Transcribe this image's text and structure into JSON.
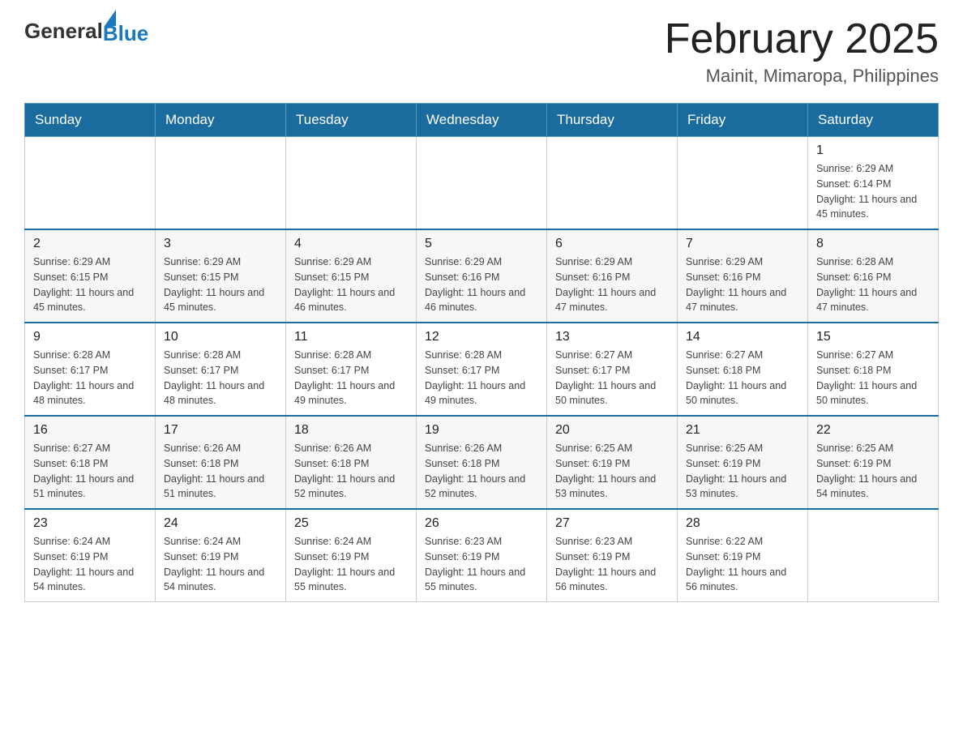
{
  "header": {
    "logo_general": "General",
    "logo_blue": "Blue",
    "title": "February 2025",
    "subtitle": "Mainit, Mimaropa, Philippines"
  },
  "days_of_week": [
    "Sunday",
    "Monday",
    "Tuesday",
    "Wednesday",
    "Thursday",
    "Friday",
    "Saturday"
  ],
  "weeks": [
    [
      {
        "day": "",
        "sunrise": "",
        "sunset": "",
        "daylight": ""
      },
      {
        "day": "",
        "sunrise": "",
        "sunset": "",
        "daylight": ""
      },
      {
        "day": "",
        "sunrise": "",
        "sunset": "",
        "daylight": ""
      },
      {
        "day": "",
        "sunrise": "",
        "sunset": "",
        "daylight": ""
      },
      {
        "day": "",
        "sunrise": "",
        "sunset": "",
        "daylight": ""
      },
      {
        "day": "",
        "sunrise": "",
        "sunset": "",
        "daylight": ""
      },
      {
        "day": "1",
        "sunrise": "Sunrise: 6:29 AM",
        "sunset": "Sunset: 6:14 PM",
        "daylight": "Daylight: 11 hours and 45 minutes."
      }
    ],
    [
      {
        "day": "2",
        "sunrise": "Sunrise: 6:29 AM",
        "sunset": "Sunset: 6:15 PM",
        "daylight": "Daylight: 11 hours and 45 minutes."
      },
      {
        "day": "3",
        "sunrise": "Sunrise: 6:29 AM",
        "sunset": "Sunset: 6:15 PM",
        "daylight": "Daylight: 11 hours and 45 minutes."
      },
      {
        "day": "4",
        "sunrise": "Sunrise: 6:29 AM",
        "sunset": "Sunset: 6:15 PM",
        "daylight": "Daylight: 11 hours and 46 minutes."
      },
      {
        "day": "5",
        "sunrise": "Sunrise: 6:29 AM",
        "sunset": "Sunset: 6:16 PM",
        "daylight": "Daylight: 11 hours and 46 minutes."
      },
      {
        "day": "6",
        "sunrise": "Sunrise: 6:29 AM",
        "sunset": "Sunset: 6:16 PM",
        "daylight": "Daylight: 11 hours and 47 minutes."
      },
      {
        "day": "7",
        "sunrise": "Sunrise: 6:29 AM",
        "sunset": "Sunset: 6:16 PM",
        "daylight": "Daylight: 11 hours and 47 minutes."
      },
      {
        "day": "8",
        "sunrise": "Sunrise: 6:28 AM",
        "sunset": "Sunset: 6:16 PM",
        "daylight": "Daylight: 11 hours and 47 minutes."
      }
    ],
    [
      {
        "day": "9",
        "sunrise": "Sunrise: 6:28 AM",
        "sunset": "Sunset: 6:17 PM",
        "daylight": "Daylight: 11 hours and 48 minutes."
      },
      {
        "day": "10",
        "sunrise": "Sunrise: 6:28 AM",
        "sunset": "Sunset: 6:17 PM",
        "daylight": "Daylight: 11 hours and 48 minutes."
      },
      {
        "day": "11",
        "sunrise": "Sunrise: 6:28 AM",
        "sunset": "Sunset: 6:17 PM",
        "daylight": "Daylight: 11 hours and 49 minutes."
      },
      {
        "day": "12",
        "sunrise": "Sunrise: 6:28 AM",
        "sunset": "Sunset: 6:17 PM",
        "daylight": "Daylight: 11 hours and 49 minutes."
      },
      {
        "day": "13",
        "sunrise": "Sunrise: 6:27 AM",
        "sunset": "Sunset: 6:17 PM",
        "daylight": "Daylight: 11 hours and 50 minutes."
      },
      {
        "day": "14",
        "sunrise": "Sunrise: 6:27 AM",
        "sunset": "Sunset: 6:18 PM",
        "daylight": "Daylight: 11 hours and 50 minutes."
      },
      {
        "day": "15",
        "sunrise": "Sunrise: 6:27 AM",
        "sunset": "Sunset: 6:18 PM",
        "daylight": "Daylight: 11 hours and 50 minutes."
      }
    ],
    [
      {
        "day": "16",
        "sunrise": "Sunrise: 6:27 AM",
        "sunset": "Sunset: 6:18 PM",
        "daylight": "Daylight: 11 hours and 51 minutes."
      },
      {
        "day": "17",
        "sunrise": "Sunrise: 6:26 AM",
        "sunset": "Sunset: 6:18 PM",
        "daylight": "Daylight: 11 hours and 51 minutes."
      },
      {
        "day": "18",
        "sunrise": "Sunrise: 6:26 AM",
        "sunset": "Sunset: 6:18 PM",
        "daylight": "Daylight: 11 hours and 52 minutes."
      },
      {
        "day": "19",
        "sunrise": "Sunrise: 6:26 AM",
        "sunset": "Sunset: 6:18 PM",
        "daylight": "Daylight: 11 hours and 52 minutes."
      },
      {
        "day": "20",
        "sunrise": "Sunrise: 6:25 AM",
        "sunset": "Sunset: 6:19 PM",
        "daylight": "Daylight: 11 hours and 53 minutes."
      },
      {
        "day": "21",
        "sunrise": "Sunrise: 6:25 AM",
        "sunset": "Sunset: 6:19 PM",
        "daylight": "Daylight: 11 hours and 53 minutes."
      },
      {
        "day": "22",
        "sunrise": "Sunrise: 6:25 AM",
        "sunset": "Sunset: 6:19 PM",
        "daylight": "Daylight: 11 hours and 54 minutes."
      }
    ],
    [
      {
        "day": "23",
        "sunrise": "Sunrise: 6:24 AM",
        "sunset": "Sunset: 6:19 PM",
        "daylight": "Daylight: 11 hours and 54 minutes."
      },
      {
        "day": "24",
        "sunrise": "Sunrise: 6:24 AM",
        "sunset": "Sunset: 6:19 PM",
        "daylight": "Daylight: 11 hours and 54 minutes."
      },
      {
        "day": "25",
        "sunrise": "Sunrise: 6:24 AM",
        "sunset": "Sunset: 6:19 PM",
        "daylight": "Daylight: 11 hours and 55 minutes."
      },
      {
        "day": "26",
        "sunrise": "Sunrise: 6:23 AM",
        "sunset": "Sunset: 6:19 PM",
        "daylight": "Daylight: 11 hours and 55 minutes."
      },
      {
        "day": "27",
        "sunrise": "Sunrise: 6:23 AM",
        "sunset": "Sunset: 6:19 PM",
        "daylight": "Daylight: 11 hours and 56 minutes."
      },
      {
        "day": "28",
        "sunrise": "Sunrise: 6:22 AM",
        "sunset": "Sunset: 6:19 PM",
        "daylight": "Daylight: 11 hours and 56 minutes."
      },
      {
        "day": "",
        "sunrise": "",
        "sunset": "",
        "daylight": ""
      }
    ]
  ]
}
